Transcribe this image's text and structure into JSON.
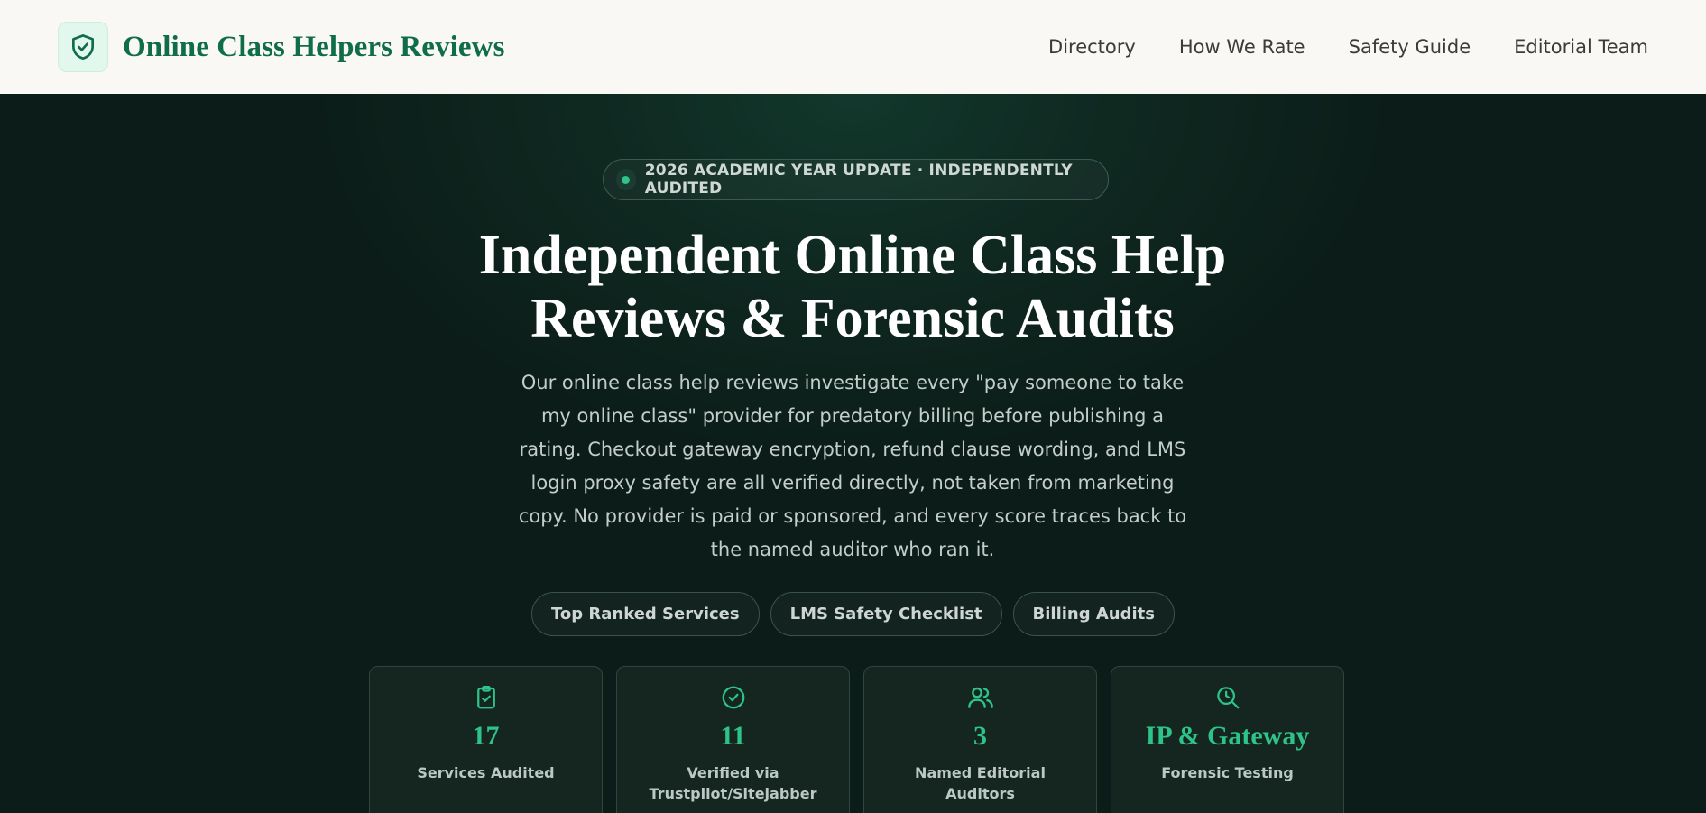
{
  "header": {
    "brand_title": "Online Class Helpers Reviews",
    "logo_icon": "shield-check-icon",
    "nav": [
      {
        "label": "Directory"
      },
      {
        "label": "How We Rate"
      },
      {
        "label": "Safety Guide"
      },
      {
        "label": "Editorial Team"
      }
    ]
  },
  "hero": {
    "badge": "2026 ACADEMIC YEAR UPDATE · INDEPENDENTLY AUDITED",
    "title_line1": "Independent Online Class Help",
    "title_line2": "Reviews & Forensic Audits",
    "description": "Our online class help reviews investigate every \"pay someone to take my online class\" provider for predatory billing before publishing a rating. Checkout gateway encryption, refund clause wording, and LMS login proxy safety are all verified directly, not taken from marketing copy. No provider is paid or sponsored, and every score traces back to the named auditor who ran it.",
    "pills": [
      {
        "label": "Top Ranked Services"
      },
      {
        "label": "LMS Safety Checklist"
      },
      {
        "label": "Billing Audits"
      }
    ]
  },
  "stats": [
    {
      "icon": "clipboard-check-icon",
      "value": "17",
      "label": "Services Audited"
    },
    {
      "icon": "check-circle-icon",
      "value": "11",
      "label": "Verified via Trustpilot/Sitejabber"
    },
    {
      "icon": "users-icon",
      "value": "3",
      "label": "Named Editorial Auditors"
    },
    {
      "icon": "search-clock-icon",
      "value": "IP & Gateway",
      "label": "Forensic Testing"
    }
  ],
  "colors": {
    "brand": "#0f6d4b",
    "accent": "#2ec38a",
    "hero_bg": "#0c1c18",
    "header_bg": "#f9f8f4"
  }
}
